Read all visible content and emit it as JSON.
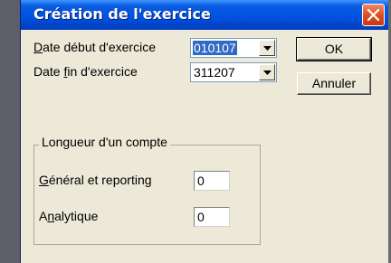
{
  "dialog": {
    "title": "Création de l'exercice",
    "close_icon": "close-icon"
  },
  "fields": {
    "date_debut": {
      "label_mnemonic": "D",
      "label_rest": "ate début d'exercice",
      "value": "010107"
    },
    "date_fin": {
      "label_pre": "Date ",
      "label_mnemonic": "f",
      "label_rest": "in d'exercice",
      "value": "311207"
    }
  },
  "buttons": {
    "ok": "OK",
    "annuler": "Annuler"
  },
  "group": {
    "title": "Longueur d'un compte",
    "general": {
      "label_mnemonic": "G",
      "label_rest": "énéral et reporting",
      "value": "0"
    },
    "analytique": {
      "label_pre": "A",
      "label_mnemonic": "n",
      "label_rest": "alytique",
      "value": "0"
    }
  },
  "colors": {
    "titlebar": "#0054e3",
    "dialog_bg": "#ece9d8",
    "selection": "#316ac5",
    "close_button": "#e04e24"
  }
}
